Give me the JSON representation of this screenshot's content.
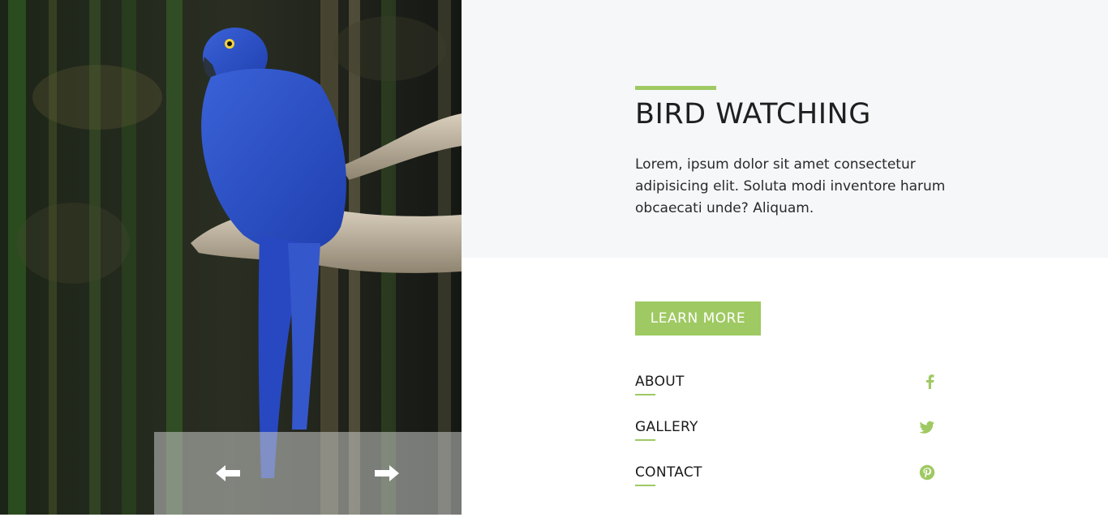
{
  "hero": {
    "title": "BIRD WATCHING",
    "description": "Lorem, ipsum dolor sit amet consectetur adipisicing elit. Soluta modi inventore harum obcaecati unde? Aliquam.",
    "cta_label": "LEARN MORE"
  },
  "nav": {
    "items": [
      {
        "label": "ABOUT",
        "icon": "facebook-icon"
      },
      {
        "label": "GALLERY",
        "icon": "twitter-icon"
      },
      {
        "label": "CONTACT",
        "icon": "pinterest-icon"
      }
    ]
  },
  "slider": {
    "prev_icon": "arrow-left-icon",
    "next_icon": "arrow-right-icon"
  },
  "colors": {
    "accent": "#9fc962",
    "band": "#f6f7f9",
    "text": "#1f1f1f"
  }
}
